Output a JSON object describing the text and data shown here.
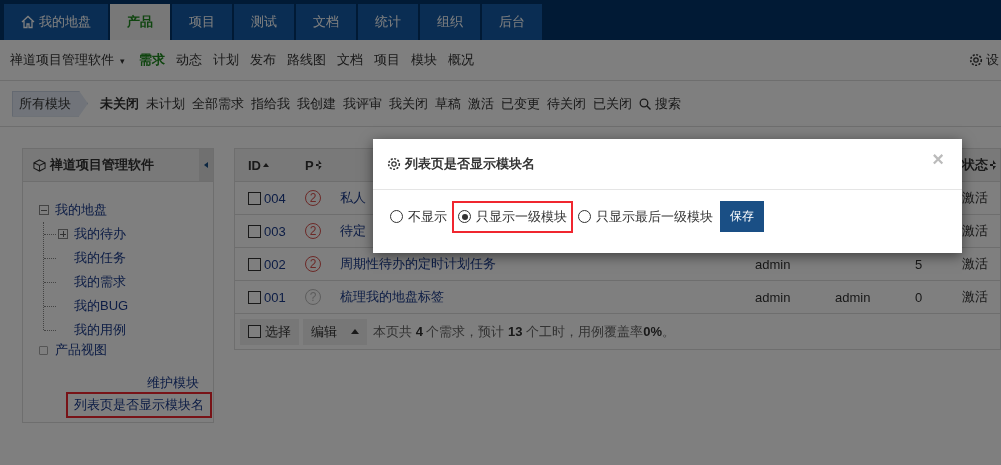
{
  "main_nav": [
    {
      "label": "我的地盘",
      "selected": false
    },
    {
      "label": "产品",
      "selected": true
    },
    {
      "label": "项目",
      "selected": false
    },
    {
      "label": "测试",
      "selected": false
    },
    {
      "label": "文档",
      "selected": false
    },
    {
      "label": "统计",
      "selected": false
    },
    {
      "label": "组织",
      "selected": false
    },
    {
      "label": "后台",
      "selected": false
    }
  ],
  "sub_nav": {
    "product": "禅道项目管理软件",
    "product_caret": "▾",
    "links": [
      {
        "label": "需求",
        "selected": true
      },
      {
        "label": "动态",
        "selected": false
      },
      {
        "label": "计划",
        "selected": false
      },
      {
        "label": "发布",
        "selected": false
      },
      {
        "label": "路线图",
        "selected": false
      },
      {
        "label": "文档",
        "selected": false
      },
      {
        "label": "项目",
        "selected": false
      },
      {
        "label": "模块",
        "selected": false
      },
      {
        "label": "概况",
        "selected": false
      }
    ],
    "settings": "设"
  },
  "filter_bar": {
    "module": "所有模块",
    "filters": [
      {
        "label": "未关闭",
        "selected": true
      },
      {
        "label": "未计划",
        "selected": false
      },
      {
        "label": "全部需求",
        "selected": false
      },
      {
        "label": "指给我",
        "selected": false
      },
      {
        "label": "我创建",
        "selected": false
      },
      {
        "label": "我评审",
        "selected": false
      },
      {
        "label": "我关闭",
        "selected": false
      },
      {
        "label": "草稿",
        "selected": false
      },
      {
        "label": "激活",
        "selected": false
      },
      {
        "label": "已变更",
        "selected": false
      },
      {
        "label": "待关闭",
        "selected": false
      },
      {
        "label": "已关闭",
        "selected": false
      }
    ],
    "search": "搜索"
  },
  "sidebar": {
    "title": "禅道项目管理软件",
    "tree": [
      {
        "label": "我的地盘",
        "expanded": true,
        "children": [
          {
            "label": "我的待办",
            "expanded": false
          },
          {
            "label": "我的任务"
          },
          {
            "label": "我的需求"
          },
          {
            "label": "我的BUG"
          },
          {
            "label": "我的用例"
          }
        ]
      },
      {
        "label": "产品视图"
      }
    ],
    "links": [
      {
        "label": "维护模块",
        "highlighted": false
      },
      {
        "label": "列表页是否显示模块名",
        "highlighted": true
      }
    ]
  },
  "table": {
    "columns": [
      {
        "label": "ID",
        "sorted": true
      },
      {
        "label": "P",
        "sorted": false
      },
      {
        "label": "状态",
        "sorted": false
      }
    ],
    "rows": [
      {
        "id": "004",
        "checked": false,
        "pri": {
          "label": "2",
          "kind": "set"
        },
        "title": "私人",
        "status": "激活"
      },
      {
        "id": "003",
        "checked": false,
        "pri": {
          "label": "2",
          "kind": "set"
        },
        "title": "待定",
        "status": "激活"
      },
      {
        "id": "002",
        "checked": false,
        "pri": {
          "label": "2",
          "kind": "set"
        },
        "title": "周期性待办的定时计划任务",
        "opened_by": "admin",
        "estimate": "5",
        "status": "激活"
      },
      {
        "id": "001",
        "checked": false,
        "pri": {
          "label": "?",
          "kind": "unset"
        },
        "title": "梳理我的地盘标签",
        "opened_by": "admin",
        "assigned_to": "admin",
        "estimate": "0",
        "status": "激活"
      }
    ],
    "footer": {
      "select_all": "选择",
      "select_all_checked": false,
      "edit": "编辑",
      "summary": "本页共 **4** 个需求，预计 **13** 个工时，用例覆盖率**0%**。"
    }
  },
  "modal": {
    "title": "列表页是否显示模块名",
    "close": "×",
    "options": [
      {
        "label": "不显示",
        "selected": false,
        "highlighted": false
      },
      {
        "label": "只显示一级模块",
        "selected": true,
        "highlighted": true
      },
      {
        "label": "只显示最后一级模块",
        "selected": false,
        "highlighted": false
      }
    ],
    "save": "保存"
  }
}
